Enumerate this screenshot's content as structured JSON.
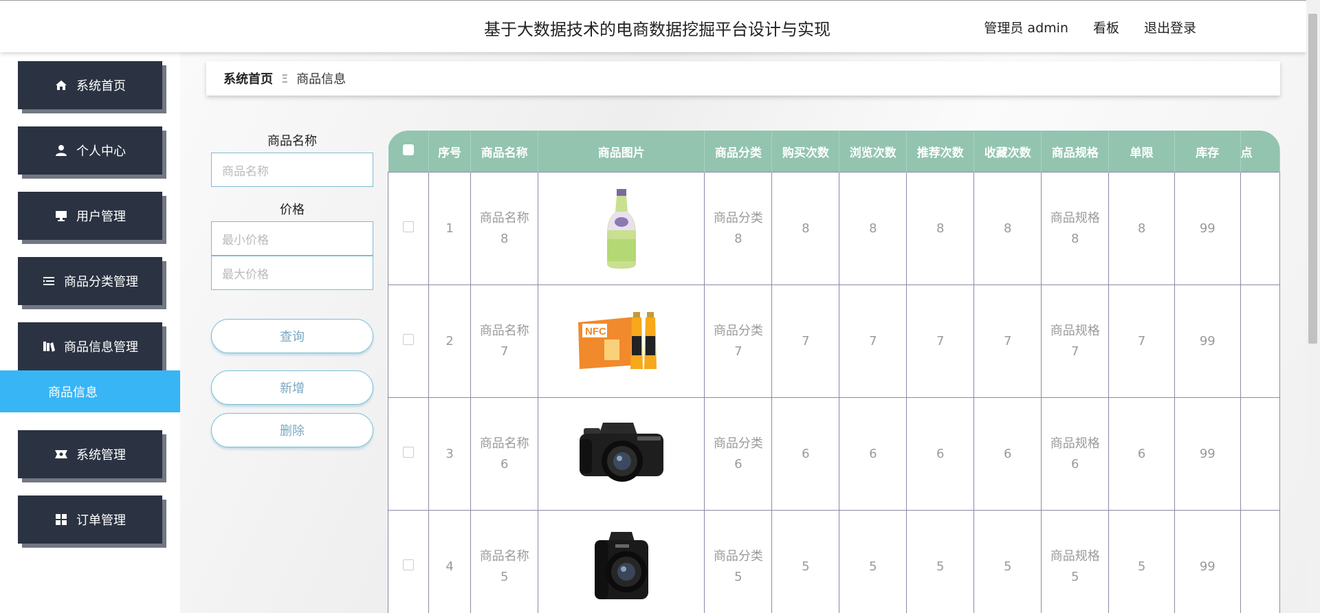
{
  "header": {
    "title": "基于大数据技术的电商数据挖掘平台设计与实现",
    "user_label": "管理员 admin",
    "dashboard_label": "看板",
    "logout_label": "退出登录"
  },
  "sidebar": {
    "items": [
      {
        "label": "系统首页",
        "icon": "home-icon"
      },
      {
        "label": "个人中心",
        "icon": "user-icon"
      },
      {
        "label": "用户管理",
        "icon": "monitor-icon"
      },
      {
        "label": "商品分类管理",
        "icon": "list-icon"
      },
      {
        "label": "商品信息管理",
        "icon": "books-icon"
      },
      {
        "label": "系统管理",
        "icon": "ticket-icon"
      },
      {
        "label": "订单管理",
        "icon": "grid-icon"
      }
    ],
    "active_sub": "商品信息"
  },
  "breadcrumb": {
    "home": "系统首页",
    "separator": "Ξ",
    "current": "商品信息"
  },
  "search": {
    "name_label": "商品名称",
    "name_placeholder": "商品名称",
    "price_label": "价格",
    "min_placeholder": "最小价格",
    "max_placeholder": "最大价格",
    "query_label": "查询",
    "add_label": "新增",
    "delete_label": "删除"
  },
  "table": {
    "columns": [
      "序号",
      "商品名称",
      "商品图片",
      "商品分类",
      "购买次数",
      "浏览次数",
      "推荐次数",
      "收藏次数",
      "商品规格",
      "单限",
      "库存",
      "点"
    ],
    "rows": [
      {
        "index": "1",
        "name": "商品名称8",
        "image": "juice-bottle",
        "category": "商品分类8",
        "buys": "8",
        "views": "8",
        "recs": "8",
        "favs": "8",
        "spec": "商品规格8",
        "limit": "8",
        "stock": "99"
      },
      {
        "index": "2",
        "name": "商品名称7",
        "image": "nfc-juice-box",
        "category": "商品分类7",
        "buys": "7",
        "views": "7",
        "recs": "7",
        "favs": "7",
        "spec": "商品规格7",
        "limit": "7",
        "stock": "99"
      },
      {
        "index": "3",
        "name": "商品名称6",
        "image": "mirrorless-camera",
        "category": "商品分类6",
        "buys": "6",
        "views": "6",
        "recs": "6",
        "favs": "6",
        "spec": "商品规格6",
        "limit": "6",
        "stock": "99"
      },
      {
        "index": "4",
        "name": "商品名称5",
        "image": "dslr-camera",
        "category": "商品分类5",
        "buys": "5",
        "views": "5",
        "recs": "5",
        "favs": "5",
        "spec": "商品规格5",
        "limit": "5",
        "stock": "99"
      }
    ],
    "image_labels": {
      "nfc": "NFC"
    }
  },
  "colors": {
    "header_bg": "#93c4b0",
    "nav_bg": "#2b3342",
    "active_bg": "#38b5f5",
    "accent_border": "#7bbcd6"
  }
}
